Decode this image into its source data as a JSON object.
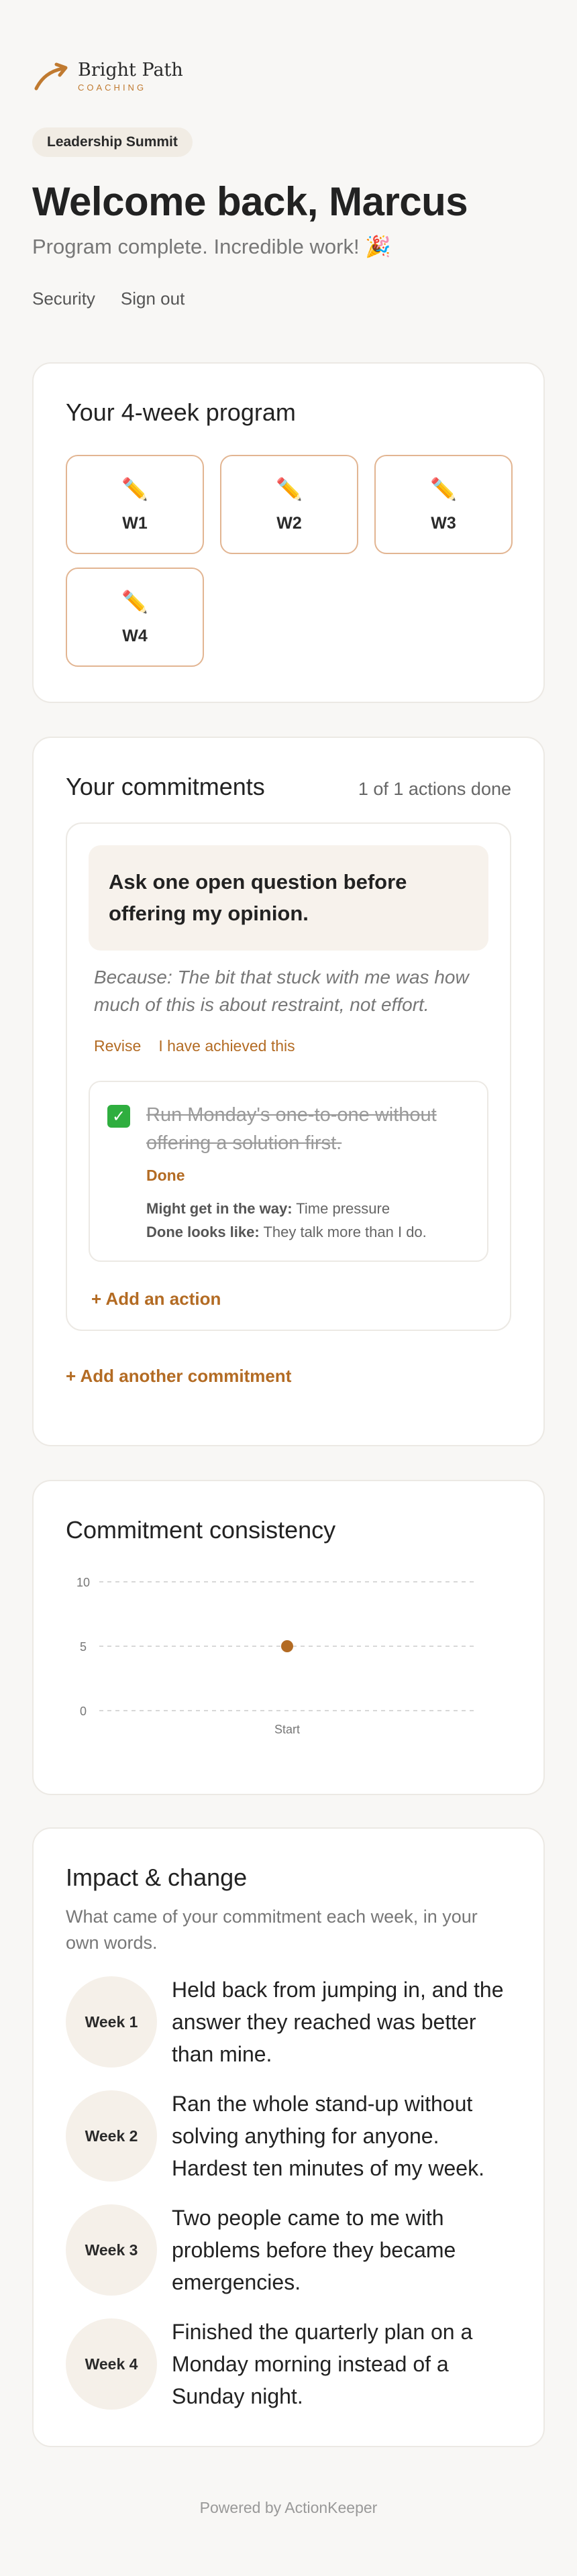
{
  "brand": {
    "name": "Bright Path",
    "sub": "COACHING"
  },
  "header": {
    "pill": "Leadership Summit",
    "welcome": "Welcome back, Marcus",
    "subline": "Program complete. Incredible work! 🎉",
    "links": [
      "Security",
      "Sign out"
    ]
  },
  "program": {
    "title": "Your 4-week program",
    "weeks": [
      {
        "label": "W1",
        "icon": "pencil-icon"
      },
      {
        "label": "W2",
        "icon": "pencil-icon"
      },
      {
        "label": "W3",
        "icon": "pencil-icon"
      },
      {
        "label": "W4",
        "icon": "pencil-icon"
      }
    ]
  },
  "commitments": {
    "title": "Your commitments",
    "count": "1 of 1 actions done",
    "goal": "Ask one open question before offering my opinion.",
    "because": "Because: The bit that stuck with me was how much of this is about restraint, not effort.",
    "revise": "Revise",
    "achieved": "I have achieved this",
    "action": {
      "text": "Run Monday's one-to-one without offering a solution first.",
      "status": "Done",
      "obstacle_label": "Might get in the way:",
      "obstacle": "Time pressure",
      "done_label": "Done looks like:",
      "done_value": "They talk more than I do."
    },
    "add_action": "+ Add an action",
    "add_commitment": "+ Add another commitment"
  },
  "consistency": {
    "title": "Commitment consistency"
  },
  "chart_data": {
    "type": "scatter",
    "categories": [
      "Start"
    ],
    "values": [
      5
    ],
    "yticks": [
      0,
      5,
      10
    ],
    "ylim": [
      0,
      10
    ],
    "grid": true,
    "color": "#b36b23"
  },
  "impact": {
    "title": "Impact & change",
    "subtitle": "What came of your commitment each week, in your own words.",
    "items": [
      {
        "week": "Week 1",
        "text": "Held back from jumping in, and the answer they reached was better than mine."
      },
      {
        "week": "Week 2",
        "text": "Ran the whole stand-up without solving anything for anyone. Hardest ten minutes of my week."
      },
      {
        "week": "Week 3",
        "text": "Two people came to me with problems before they became emergencies."
      },
      {
        "week": "Week 4",
        "text": "Finished the quarterly plan on a Monday morning instead of a Sunday night."
      }
    ]
  },
  "footer": "Powered by ActionKeeper",
  "colors": {
    "accent": "#b36b23",
    "success": "#2fae3f",
    "border_accent": "#e2b592"
  }
}
